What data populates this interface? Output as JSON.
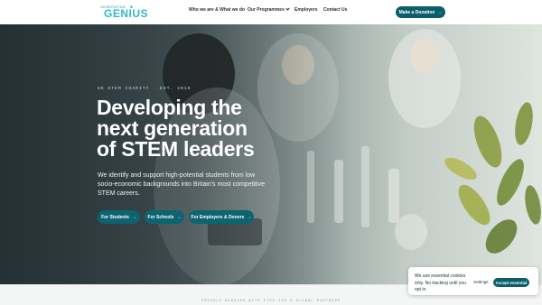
{
  "logo": {
    "small": "GENERATING",
    "big": "GENIUS"
  },
  "nav": {
    "who_we_are": "Who we are & What we do",
    "programmes": "Our Programmes",
    "employers": "Employers",
    "contact": "Contact Us",
    "donate": "Make a Donation",
    "donate_arrow": "→"
  },
  "hero": {
    "eyebrow": "UK STEM CHARITY · EST. 2016",
    "headline_line1": "Developing the",
    "headline_line2": "next generation",
    "headline_line3": "of STEM leaders",
    "subtext": "We identify and support high-potential students from low socio-economic backgrounds into Britain's most competitive STEM careers.",
    "cta_students": "For Students",
    "cta_schools": "For Schools",
    "cta_employers": "For Employers & Donors",
    "arrow": "→"
  },
  "footer": {
    "partners_text": "PROUDLY WORKING WITH FTSE 100 & GLOBAL PARTNERS"
  },
  "cookie": {
    "text": "We use essential cookies only. No tracking until you opt in.",
    "settings": "Settings",
    "accept": "Accept essential"
  },
  "colors": {
    "brand_teal": "#0c5e6c",
    "logo_teal": "#33b8c9"
  }
}
